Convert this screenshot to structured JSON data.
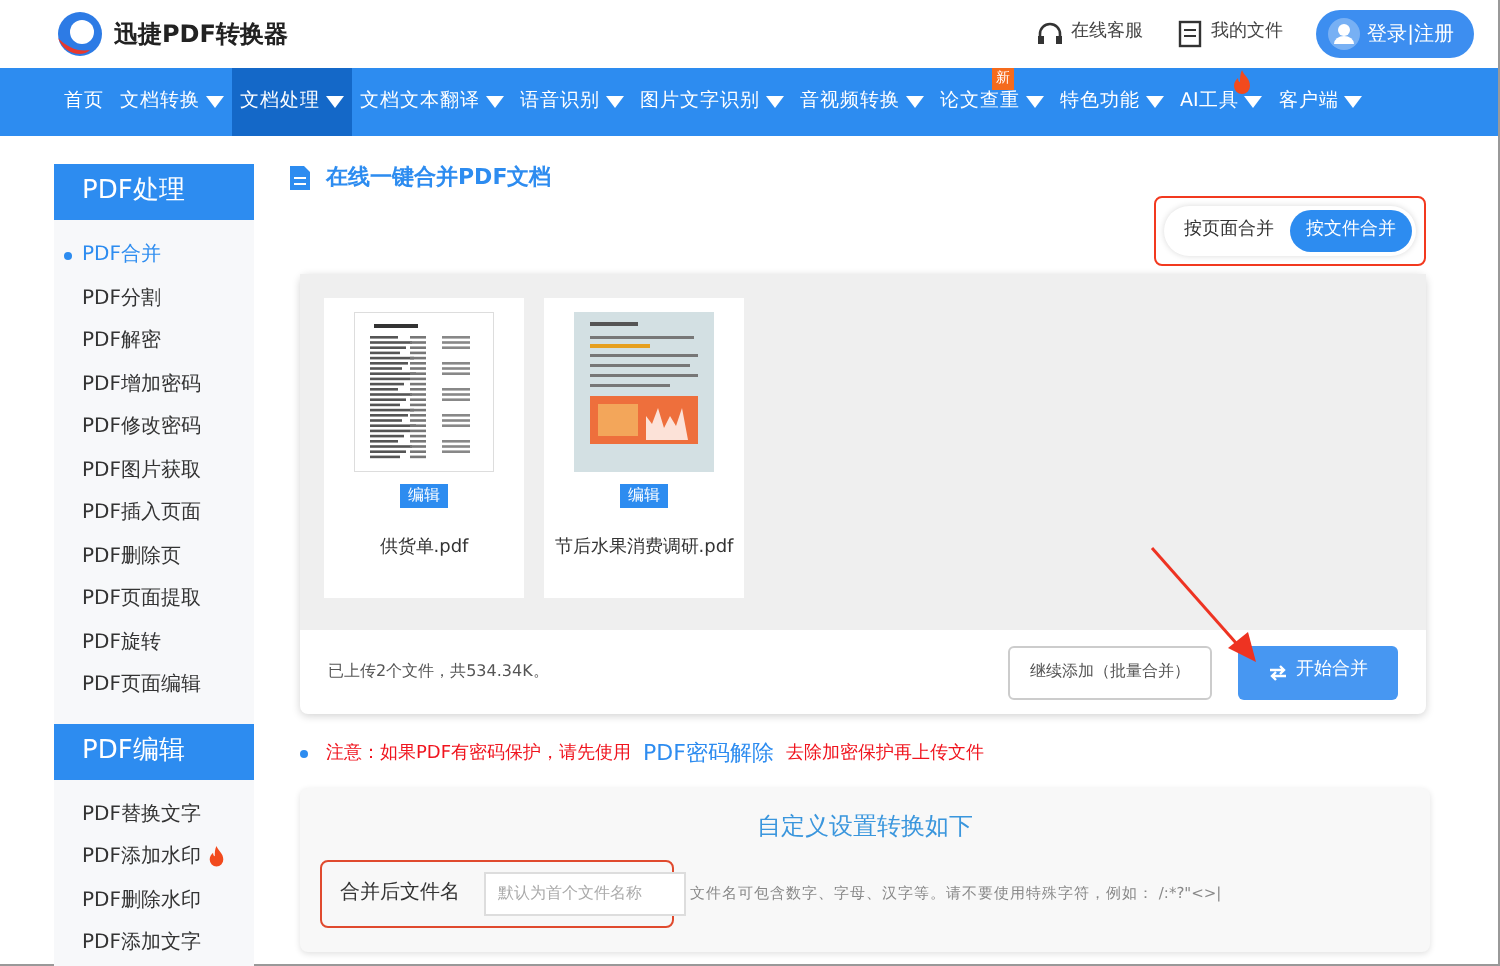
{
  "logo": {
    "text": "迅捷PDF转换器"
  },
  "header_links": [
    {
      "label": "在线客服",
      "kind": "headset"
    },
    {
      "label": "我的文件",
      "kind": "file"
    }
  ],
  "login_button": "登录|注册",
  "nav": [
    {
      "label": "首页",
      "selected": false,
      "dropdown": false
    },
    {
      "label": "文档转换",
      "selected": false,
      "dropdown": true
    },
    {
      "label": "文档处理",
      "selected": true,
      "dropdown": true
    },
    {
      "label": "文档文本翻译",
      "selected": false,
      "dropdown": true
    },
    {
      "label": "语音识别",
      "selected": false,
      "dropdown": true
    },
    {
      "label": "图片文字识别",
      "selected": false,
      "dropdown": true
    },
    {
      "label": "音视频转换",
      "selected": false,
      "dropdown": true
    },
    {
      "label": "论文查重",
      "selected": false,
      "dropdown": true,
      "badge": "新"
    },
    {
      "label": "特色功能",
      "selected": false,
      "dropdown": true
    },
    {
      "label": "AI工具",
      "selected": false,
      "dropdown": true,
      "hot": true
    },
    {
      "label": "客户端",
      "selected": false,
      "dropdown": true
    }
  ],
  "sidebar": [
    {
      "title": "PDF处理",
      "items": [
        {
          "label": "PDF合并",
          "selected": true,
          "hot": false
        },
        {
          "label": "PDF分割",
          "selected": false,
          "hot": false
        },
        {
          "label": "PDF解密",
          "selected": false,
          "hot": false
        },
        {
          "label": "PDF增加密码",
          "selected": false,
          "hot": false
        },
        {
          "label": "PDF修改密码",
          "selected": false,
          "hot": false
        },
        {
          "label": "PDF图片获取",
          "selected": false,
          "hot": false
        },
        {
          "label": "PDF插入页面",
          "selected": false,
          "hot": false
        },
        {
          "label": "PDF删除页",
          "selected": false,
          "hot": false
        },
        {
          "label": "PDF页面提取",
          "selected": false,
          "hot": false
        },
        {
          "label": "PDF旋转",
          "selected": false,
          "hot": false
        },
        {
          "label": "PDF页面编辑",
          "selected": false,
          "hot": false
        }
      ]
    },
    {
      "title": "PDF编辑",
      "items": [
        {
          "label": "PDF替换文字",
          "selected": false,
          "hot": false
        },
        {
          "label": "PDF添加水印",
          "selected": false,
          "hot": true
        },
        {
          "label": "PDF删除水印",
          "selected": false,
          "hot": false
        },
        {
          "label": "PDF添加文字",
          "selected": false,
          "hot": false
        }
      ]
    }
  ],
  "page_title": "在线一键合并PDF文档",
  "merge_modes": {
    "highlighted": true,
    "options": [
      {
        "label": "按页面合并",
        "selected": false
      },
      {
        "label": "按文件合并",
        "selected": true
      }
    ]
  },
  "files": [
    {
      "name": "供货单.pdf",
      "edit_label": "编辑",
      "kind": "table"
    },
    {
      "name": "节后水果消费调研.pdf",
      "edit_label": "编辑",
      "kind": "report"
    }
  ],
  "upload_summary": "已上传2个文件，共534.34K。",
  "add_more_button": "继续添加（批量合并）",
  "start_button": {
    "label": "开始合并",
    "pointed_at": true
  },
  "notice": {
    "prefix": "注意：如果PDF有密码保护，请先使用",
    "link": "PDF密码解除",
    "suffix": "去除加密保护再上传文件"
  },
  "settings": {
    "title": "自定义设置转换如下",
    "filename_label": "合并后文件名",
    "placeholder": "默认为首个文件名称",
    "highlighted": true,
    "hint": "文件名可包含数字、字母、汉字等。请不要使用特殊字符，例如： /:*?\"<>|"
  }
}
